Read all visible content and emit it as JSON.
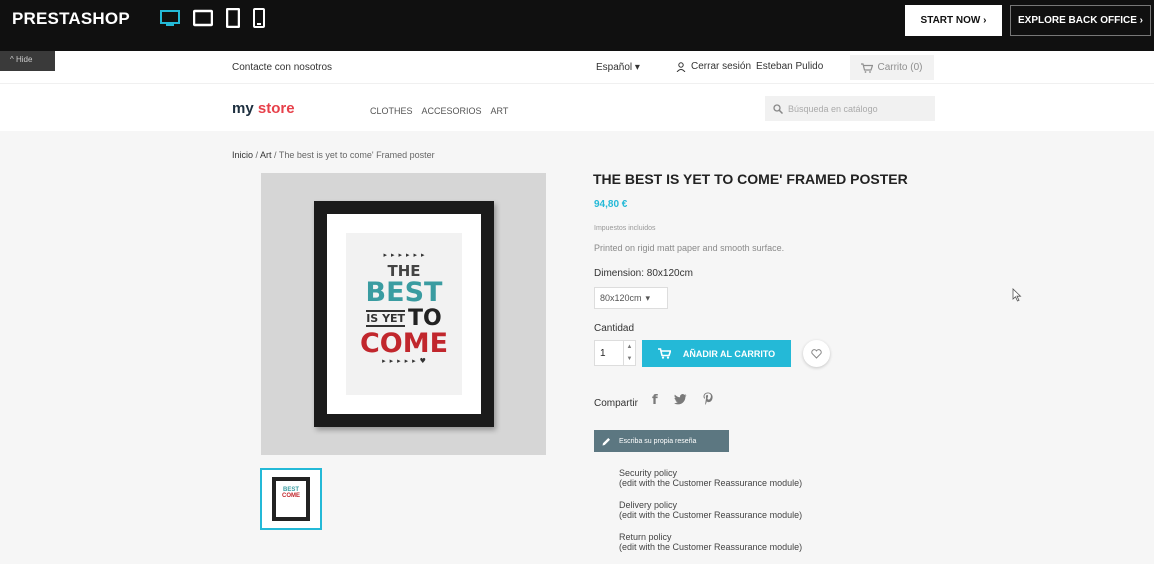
{
  "demo_bar": {
    "logo": "PRESTASHOP",
    "start_now": "START NOW ›",
    "explore": "EXPLORE BACK OFFICE ›",
    "hide": "^ Hide"
  },
  "header": {
    "contact": "Contacte con nosotros",
    "language": "Español ▾",
    "logout": "Cerrar sesión",
    "user": "Esteban Pulido",
    "cart": "Carrito (0)",
    "logo_my": "my",
    "logo_store": " store",
    "menu": [
      "CLOTHES",
      "ACCESORIOS",
      "ART"
    ],
    "search_placeholder": "Búsqueda en catálogo"
  },
  "breadcrumb": {
    "home": "Inicio",
    "sep": " / ",
    "category": "Art",
    "current": "The best is yet to come' Framed poster"
  },
  "poster": {
    "arrows": "▸▸▸▸▸▸",
    "line1": "THE",
    "line2": "BEST",
    "line3a": "IS YET",
    "line3b": "TO",
    "line4": "COME",
    "arrows_end": "▸▸▸▸▸♥"
  },
  "product": {
    "title": "THE BEST IS YET TO COME' FRAMED POSTER",
    "price": "94,80 €",
    "tax": "Impuestos incluidos",
    "description": "Printed on rigid matt paper and smooth surface.",
    "dimension_label": "Dimension: 80x120cm",
    "dimension_value": "80x120cm",
    "quantity_label": "Cantidad",
    "quantity": "1",
    "add_to_cart": "AÑADIR AL CARRITO",
    "share_label": "Compartir",
    "review": "Escriba su propia reseña"
  },
  "reassurance": [
    {
      "title": "Security policy",
      "sub": "(edit with the Customer Reassurance module)"
    },
    {
      "title": "Delivery policy",
      "sub": "(edit with the Customer Reassurance module)"
    },
    {
      "title": "Return policy",
      "sub": "(edit with the Customer Reassurance module)"
    }
  ],
  "colors": {
    "accent": "#24b9d7",
    "demo_bar": "#101010",
    "review_button": "#5c7781"
  }
}
